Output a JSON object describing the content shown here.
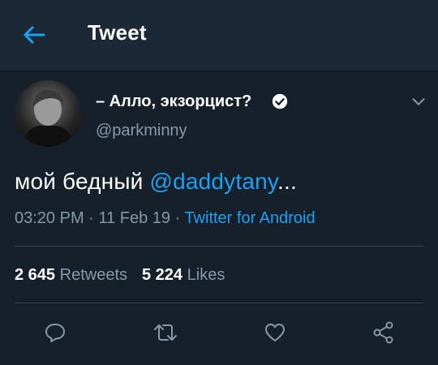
{
  "header": {
    "title": "Tweet",
    "back_icon": "arrow-left-icon"
  },
  "tweet": {
    "display_name": "– Алло, экзорцист?",
    "verified_icon": "verified-badge-icon",
    "handle": "@parkminny",
    "text_prefix": "мой бедный ",
    "mention": "@daddytany",
    "text_suffix": "...",
    "time": "03:20 PM",
    "date": "11 Feb 19",
    "separator": "·",
    "source": "Twitter for Android",
    "caret_icon": "chevron-down-icon"
  },
  "stats": {
    "retweets_count": "2 645",
    "retweets_label": "Retweets",
    "likes_count": "5 224",
    "likes_label": "Likes"
  },
  "actions": [
    "reply-icon",
    "retweet-icon",
    "like-icon",
    "share-icon"
  ],
  "colors": {
    "background": "#15202b",
    "header": "#1b2836",
    "accent": "#1da1f2",
    "secondary_text": "#8899a6",
    "divider": "#38444d"
  }
}
